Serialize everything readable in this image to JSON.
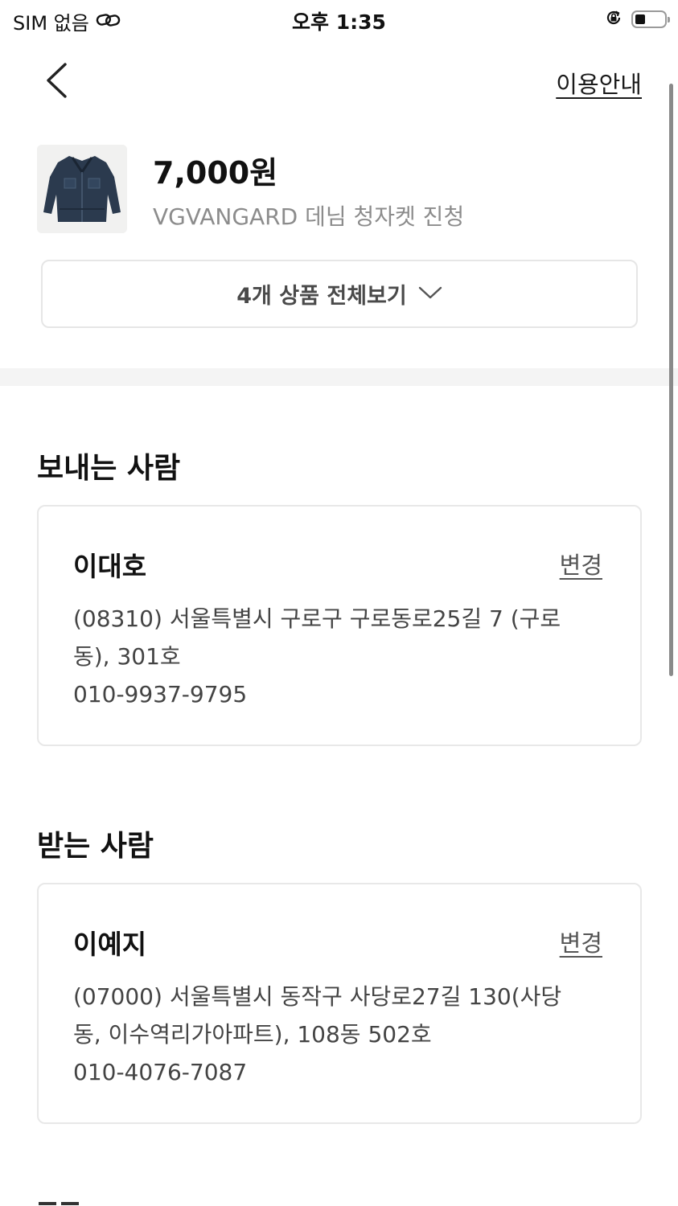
{
  "status_bar": {
    "carrier": "SIM 없음",
    "time": "오후 1:35",
    "battery_level": 0.35,
    "icons": [
      "link-icon",
      "rotation-lock-icon",
      "battery-icon"
    ]
  },
  "header": {
    "back_icon": "chevron-left-icon",
    "guide_link": "이용안내"
  },
  "product": {
    "price": "7,000원",
    "name": "VGVANGARD 데님 청자켓 진청",
    "view_all_label": "4개 상품 전체보기",
    "view_all_icon": "chevron-down-icon"
  },
  "sender": {
    "section_title": "보내는 사람",
    "name": "이대호",
    "change_label": "변경",
    "address": "(08310) 서울특별시 구로구 구로동로25길 7 (구로동), 301호",
    "phone": "010-9937-9795"
  },
  "receiver": {
    "section_title": "받는 사람",
    "name": "이예지",
    "change_label": "변경",
    "address": "(07000) 서울특별시 동작구 사당로27길 130(사당동, 이수역리가아파트), 108동 502호",
    "phone": "010-4076-7087"
  },
  "colors": {
    "text_primary": "#111111",
    "text_secondary": "#8c8c8c",
    "border": "#e8e8e8",
    "divider": "#f4f4f4"
  }
}
